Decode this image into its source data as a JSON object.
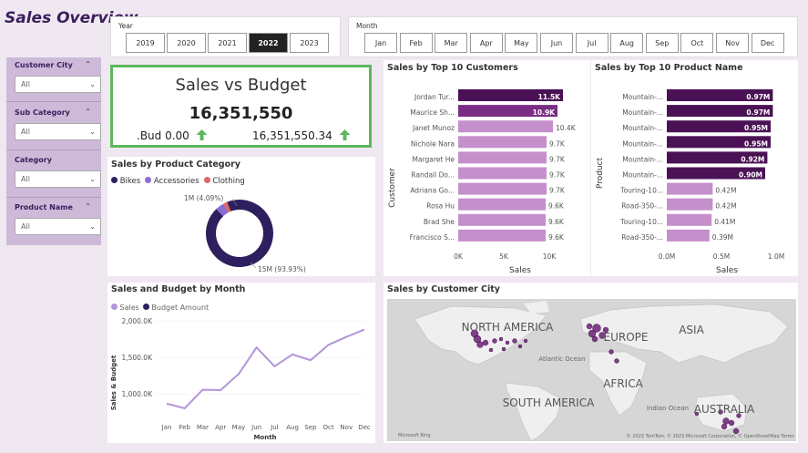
{
  "title": "Sales Overview",
  "year_slicer": {
    "label": "Year",
    "options": [
      "2019",
      "2020",
      "2021",
      "2022",
      "2023"
    ],
    "selected": "2022"
  },
  "month_slicer": {
    "label": "Month",
    "options": [
      "Jan",
      "Feb",
      "Mar",
      "Apr",
      "May",
      "Jun",
      "Jul",
      "Aug",
      "Sep",
      "Oct",
      "Nov",
      "Dec"
    ]
  },
  "filters": [
    {
      "label": "Customer City",
      "value": "All"
    },
    {
      "label": "Sub Category",
      "value": "All"
    },
    {
      "label": "Category",
      "value": "All"
    },
    {
      "label": "Product Name",
      "value": "All"
    }
  ],
  "kpi": {
    "title": "Sales vs Budget",
    "value": "16,351,550",
    "left": ".Bud 0.00",
    "right": "16,351,550.34",
    "accent": "#5cb85c"
  },
  "category_chart": {
    "title": "Sales by Product Category",
    "legend": [
      {
        "name": "Bikes",
        "color": "#2e1f5e"
      },
      {
        "name": "Accessories",
        "color": "#8c6bd3"
      },
      {
        "name": "Clothing",
        "color": "#e06464"
      }
    ],
    "labels": {
      "small": "1M (4.09%)",
      "large": "15M (93.93%)"
    },
    "chart_data": {
      "type": "pie",
      "categories": [
        "Bikes",
        "Accessories",
        "Clothing"
      ],
      "values": [
        93.93,
        4.09,
        1.98
      ]
    }
  },
  "customers_chart": {
    "title": "Sales by Top 10 Customers",
    "ylabel": "Customer",
    "xlabel": "Sales",
    "chart_data": {
      "type": "bar",
      "categories": [
        "Jordan Tur...",
        "Maurice Sh...",
        "Janet Munoz",
        "Nichole Nara",
        "Margaret He",
        "Randall Do...",
        "Adriana Go...",
        "Rosa Hu",
        "Brad She",
        "Francisco S..."
      ],
      "values": [
        11.5,
        10.9,
        10.4,
        9.7,
        9.7,
        9.7,
        9.7,
        9.6,
        9.6,
        9.6
      ],
      "value_labels": [
        "11.5K",
        "10.9K",
        "10.4K",
        "9.7K",
        "9.7K",
        "9.7K",
        "9.7K",
        "9.6K",
        "9.6K",
        "9.6K"
      ],
      "colors": [
        "#4a1254",
        "#7b2d85",
        "#c58fcb",
        "#c58fcb",
        "#c58fcb",
        "#c58fcb",
        "#c58fcb",
        "#c58fcb",
        "#c58fcb",
        "#c58fcb"
      ],
      "xticks": [
        "0K",
        "5K",
        "10K"
      ],
      "xlim": [
        0,
        10
      ]
    }
  },
  "products_chart": {
    "title": "Sales by Top 10 Product Name",
    "ylabel": "Product",
    "xlabel": "Sales",
    "chart_data": {
      "type": "bar",
      "categories": [
        "Mountain-...",
        "Mountain-...",
        "Mountain-...",
        "Mountain-...",
        "Mountain-...",
        "Mountain-...",
        "Touring-10...",
        "Road-350-...",
        "Touring-10...",
        "Road-350-..."
      ],
      "values": [
        0.97,
        0.97,
        0.95,
        0.95,
        0.92,
        0.9,
        0.42,
        0.42,
        0.41,
        0.39
      ],
      "value_labels": [
        "0.97M",
        "0.97M",
        "0.95M",
        "0.95M",
        "0.92M",
        "0.90M",
        "0.42M",
        "0.42M",
        "0.41M",
        "0.39M"
      ],
      "colors": [
        "#4a1254",
        "#4a1254",
        "#4a1254",
        "#4a1254",
        "#4a1254",
        "#4a1254",
        "#c58fcb",
        "#c58fcb",
        "#c58fcb",
        "#c58fcb"
      ],
      "xticks": [
        "0.0M",
        "0.5M",
        "1.0M"
      ],
      "xlim": [
        0,
        1.0
      ]
    }
  },
  "month_chart": {
    "title": "Sales and Budget by Month",
    "legend": [
      {
        "name": "Sales",
        "color": "#b394d8"
      },
      {
        "name": "Budget Amount",
        "color": "#2e1f5e"
      }
    ],
    "ylabel": "Sales & Budget",
    "xlabel": "Month",
    "chart_data": {
      "type": "line",
      "x": [
        "Jan",
        "Feb",
        "Mar",
        "Apr",
        "May",
        "Jun",
        "Jul",
        "Aug",
        "Sep",
        "Oct",
        "Nov",
        "Dec"
      ],
      "values": [
        865,
        800,
        1055,
        1050,
        1270,
        1635,
        1375,
        1540,
        1460,
        1670,
        1780,
        1880
      ],
      "yticks": [
        "1,000.0K",
        "1,500.0K",
        "2,000.0K"
      ],
      "ylim": [
        700,
        2000
      ]
    }
  },
  "map": {
    "title": "Sales by Customer City",
    "labels": [
      "NORTH AMERICA",
      "EUROPE",
      "ASIA",
      "Atlantic Ocean",
      "AFRICA",
      "SOUTH AMERICA",
      "Indian Ocean",
      "AUSTRALIA"
    ],
    "logo": "Microsoft Bing",
    "attribution": "© 2023 TomTom, © 2023 Microsoft Corporation, © OpenStreetMap  Terms"
  }
}
